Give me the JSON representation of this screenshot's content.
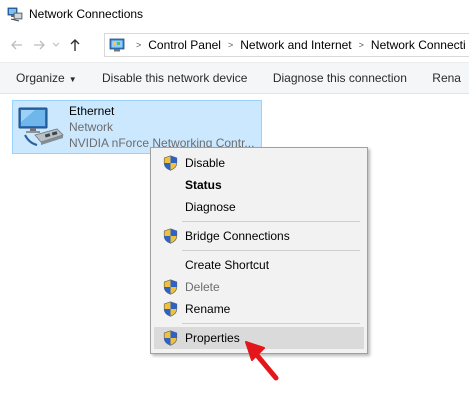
{
  "window": {
    "title": "Network Connections",
    "icon": "network-connections-icon"
  },
  "navigation": {
    "back_icon": "arrow-left-icon",
    "forward_icon": "arrow-right-icon",
    "recent_icon": "chevron-down-icon",
    "up_icon": "arrow-up-icon",
    "breadcrumbs": [
      "Control Panel",
      "Network and Internet",
      "Network Connecti"
    ]
  },
  "command_bar": {
    "organize_label": "Organize",
    "disable_label": "Disable this network device",
    "diagnose_label": "Diagnose this connection",
    "rename_label": "Rena"
  },
  "connection": {
    "name": "Ethernet",
    "status": "Network",
    "device": "NVIDIA nForce Networking Contr...",
    "selected": true
  },
  "context_menu": {
    "items": [
      {
        "label": "Disable",
        "shield": true
      },
      {
        "label": "Status",
        "bold": true
      },
      {
        "label": "Diagnose"
      },
      {
        "label": "Bridge Connections",
        "shield": true
      },
      {
        "label": "Create Shortcut"
      },
      {
        "label": "Delete",
        "shield": true,
        "disabled": true
      },
      {
        "label": "Rename",
        "shield": true
      },
      {
        "label": "Properties",
        "shield": true,
        "highlighted": true
      }
    ]
  },
  "annotation": {
    "arrow_color": "#e3161b"
  },
  "colors": {
    "selection_fill": "#cce8ff",
    "selection_border": "#99d1ff",
    "menu_background": "#f2f2f2",
    "menu_highlight": "#dadada"
  }
}
